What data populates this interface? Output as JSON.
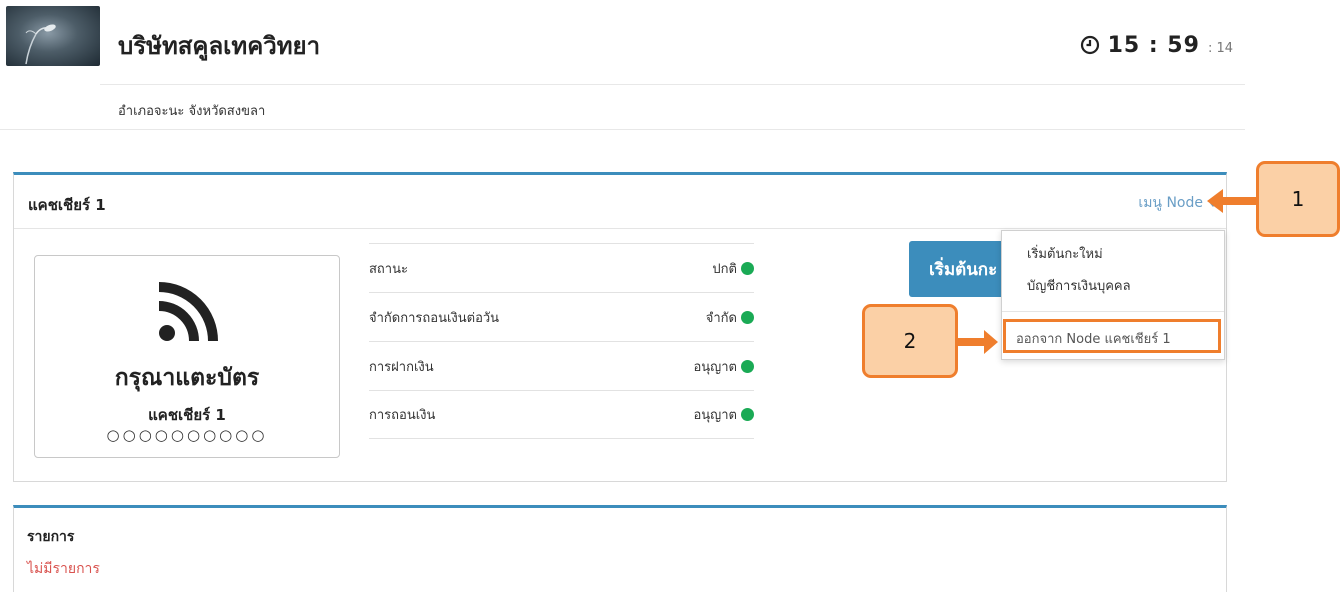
{
  "header": {
    "company_name": "บริษัทสคูลเทควิทยา",
    "address": "อำเภอจะนะ จังหวัดสงขลา",
    "clock": {
      "hours_minutes": "15 : 59",
      "seconds": ": 14"
    }
  },
  "cashier_panel": {
    "title": "แคชเชียร์ 1",
    "menu_label": "เมนู Node",
    "card": {
      "prompt": "กรุณาแตะบัตร",
      "cashier_name": "แคชเชียร์ 1",
      "dots": "○○○○○○○○○○"
    },
    "status_rows": [
      {
        "label": "สถานะ",
        "value": "ปกติ",
        "color": "#1aaa55"
      },
      {
        "label": "จำกัดการถอนเงินต่อวัน",
        "value": "จำกัด",
        "color": "#1aaa55"
      },
      {
        "label": "การฝากเงิน",
        "value": "อนุญาต",
        "color": "#1aaa55"
      },
      {
        "label": "การถอนเงิน",
        "value": "อนุญาต",
        "color": "#1aaa55"
      }
    ],
    "start_button": "เริ่มต้นกะ"
  },
  "dropdown": {
    "items": [
      "เริ่มต้นกะใหม่",
      "บัญชีการเงินบุคคล"
    ],
    "logout": "ออกจาก Node แคชเชียร์ 1"
  },
  "annotations": {
    "one": "1",
    "two": "2"
  },
  "transactions": {
    "title": "รายการ",
    "empty_text": "ไม่มีรายการ"
  },
  "colors": {
    "accent": "#3c8dbc",
    "highlight": "#ef7e2d",
    "status_ok": "#1aaa55",
    "empty": "#d9534f"
  }
}
